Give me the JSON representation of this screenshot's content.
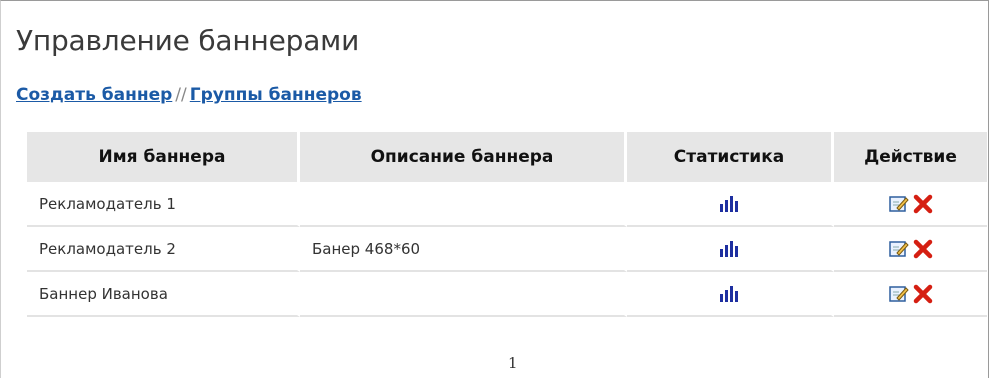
{
  "page": {
    "title": "Управление баннерами",
    "links": {
      "create": "Создать баннер",
      "separator": "//",
      "groups": "Группы баннеров"
    }
  },
  "table": {
    "headers": [
      "Имя баннера",
      "Описание баннера",
      "Статистика",
      "Действие"
    ],
    "rows": [
      {
        "name": "Рекламодатель 1",
        "description": ""
      },
      {
        "name": "Рекламодатель 2",
        "description": "Банер 468*60"
      },
      {
        "name": "Баннер Иванова",
        "description": ""
      }
    ],
    "icons": {
      "stats": "bar-chart-icon",
      "edit": "edit-icon",
      "delete": "delete-icon"
    }
  },
  "pager": {
    "current": "1"
  },
  "colors": {
    "link": "#1b5aa6",
    "header_bg": "#e6e6e6",
    "stats_icon": "#1e2fa0",
    "delete_icon": "#d51f12"
  }
}
